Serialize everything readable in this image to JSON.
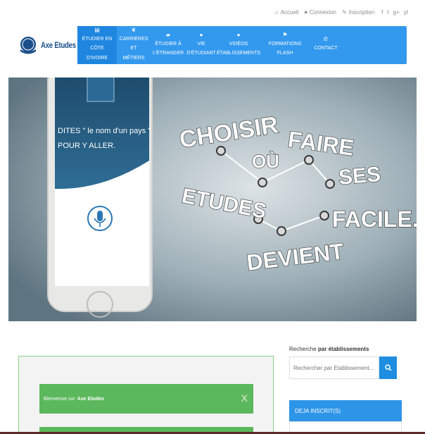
{
  "topbar": {
    "home_label": "Accueil",
    "login_label": "Connexion",
    "signup_label": "Inscription",
    "social": [
      "f",
      "t",
      "g+",
      "yt"
    ]
  },
  "logo": {
    "text": "Axe Etudes"
  },
  "nav": {
    "items": [
      {
        "line1": "ÉTUDIER EN",
        "line2": "CÔTE D'IVOIRE",
        "icon": "book-icon",
        "active": true
      },
      {
        "line1": "CARRIÈRES",
        "line2": "ET MÉTIERS",
        "icon": "leaf-icon",
        "active": false
      },
      {
        "line1": "ÉTUDIER À",
        "line2": "L'ÉTRANGER",
        "icon": "graduation-icon",
        "active": false
      },
      {
        "line1": "VIE",
        "line2": "D'ÉTUDIANT",
        "icon": "user-icon",
        "active": false
      },
      {
        "line1": "VIDÉOS",
        "line2": "ÉTABLISSEMENTS",
        "icon": "chat-icon",
        "active": false
      },
      {
        "line1": "FORMATIONS FLASH",
        "line2": "",
        "icon": "flag-icon",
        "active": false
      },
      {
        "line1": "CONTACT",
        "line2": "",
        "icon": "phone-icon",
        "active": false
      }
    ]
  },
  "hero": {
    "phone_text_line1": "DITES \" le nom d'un pays \"",
    "phone_text_line2": "POUR Y ALLER.",
    "words": [
      "CHOISIR",
      "OÙ",
      "FAIRE",
      "SES",
      "ETUDES",
      "FACILE...",
      "DEVIENT"
    ]
  },
  "welcome": {
    "prefix": "Bienvenue sur",
    "brand": "Axe Etudes",
    "close": "X"
  },
  "sidebar": {
    "search_label_plain": "Recherche",
    "search_label_bold": "par établissements",
    "search_placeholder": "Rechercher par Etablissement...",
    "deja_label": "DEJA INSCRIT(S)"
  }
}
